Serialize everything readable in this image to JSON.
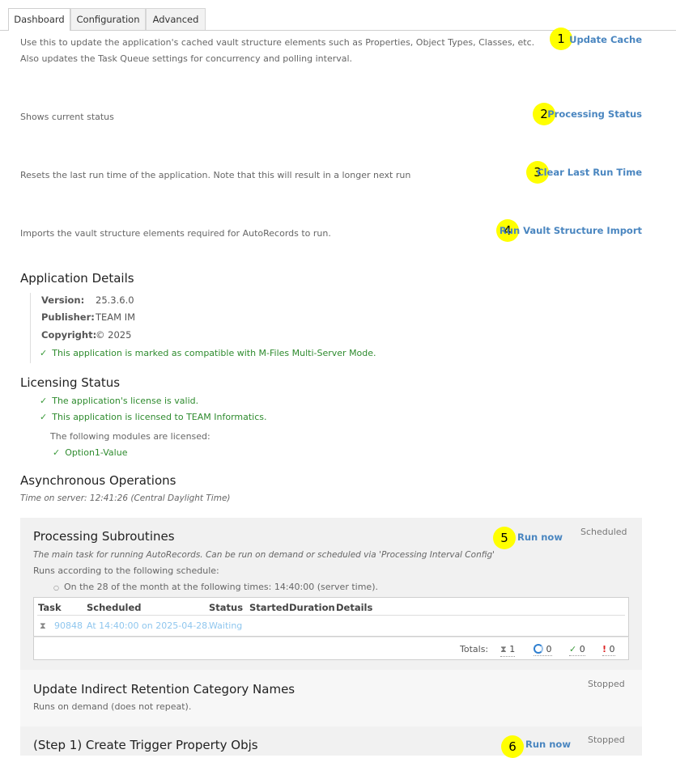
{
  "tabs": [
    "Dashboard",
    "Configuration",
    "Advanced"
  ],
  "actions": [
    {
      "description_line1": "Use this to update the application's cached vault structure elements such as Properties, Object Types, Classes, etc.",
      "description_line2": "Also updates the Task Queue settings for concurrency and polling interval.",
      "badge": "1",
      "link": "Update Cache"
    },
    {
      "description_line1": "Shows current status",
      "badge": "2",
      "link": "Processing Status"
    },
    {
      "description_line1": "Resets the last run time of the application. Note that this will result in a longer next run",
      "badge": "3",
      "link": "Clear Last Run Time"
    },
    {
      "description_line1": "Imports the vault structure elements required for AutoRecords to run.",
      "badge": "4",
      "link": "Run Vault Structure Import"
    }
  ],
  "app_details": {
    "title": "Application Details",
    "version_label": "Version:",
    "version": "25.3.6.0",
    "publisher_label": "Publisher:",
    "publisher": "TEAM IM",
    "copyright_label": "Copyright:",
    "copyright": "© 2025",
    "compat": "This application is marked as compatible with M-Files Multi-Server Mode."
  },
  "licensing": {
    "title": "Licensing Status",
    "valid": "The application's license is valid.",
    "licensed_to": "This application is licensed to TEAM Informatics.",
    "modules_intro": "The following modules are licensed:",
    "module": "Option1-Value"
  },
  "async": {
    "title": "Asynchronous Operations",
    "server_time": "Time on server: 12:41:26 (Central Daylight Time)",
    "ops": [
      {
        "title": "Processing Subroutines",
        "badge": "5",
        "run_now": "Run now",
        "state": "Scheduled",
        "description": "The main task for running AutoRecords. Can be run on demand or scheduled via 'Processing Interval Config'",
        "schedule_intro": "Runs according to the following schedule:",
        "schedule_item": "On the 28 of the month at the following times: 14:40:00 (server time).",
        "table": {
          "headers": [
            "Task",
            "Scheduled",
            "Status",
            "Started",
            "Duration",
            "Details"
          ],
          "row": {
            "task": "90848",
            "scheduled": "At 14:40:00 on 2025-04-28.",
            "status": "Waiting"
          },
          "totals_label": "Totals:",
          "totals": {
            "waiting": "1",
            "running": "0",
            "completed": "0",
            "failed": "0"
          }
        }
      },
      {
        "title": "Update Indirect Retention Category Names",
        "state": "Stopped",
        "description": "Runs on demand (does not repeat)."
      },
      {
        "title": "(Step 1) Create Trigger Property Objs",
        "badge": "6",
        "run_now": "Run now",
        "state": "Stopped"
      }
    ]
  }
}
